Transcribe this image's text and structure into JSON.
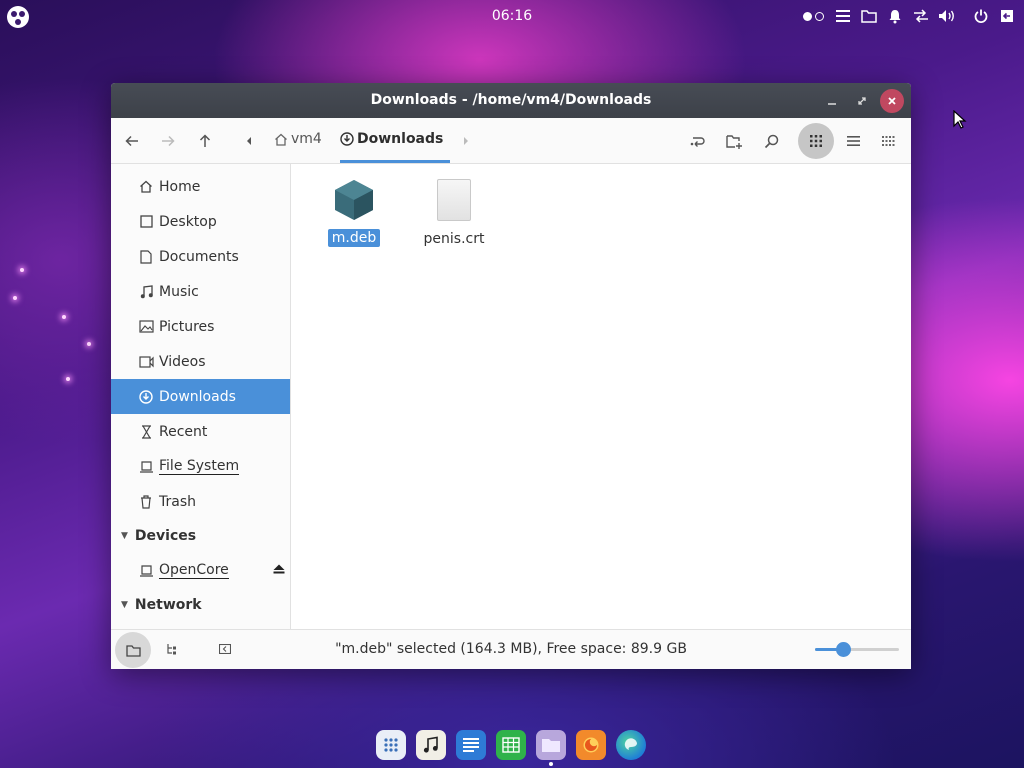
{
  "topbar": {
    "clock": "06:16",
    "tray_icons": [
      "workspace-dots-icon",
      "menu-icon",
      "folder-icon",
      "bell-icon",
      "network-icon",
      "volume-icon",
      "power-icon",
      "logout-icon"
    ]
  },
  "window": {
    "title": "Downloads - /home/vm4/Downloads"
  },
  "toolbar": {
    "breadcrumbs": [
      {
        "label": "vm4",
        "icon": "home-icon"
      },
      {
        "label": "Downloads",
        "icon": "download-icon"
      }
    ]
  },
  "sidebar": {
    "places": [
      {
        "label": "Home",
        "icon": "home-icon"
      },
      {
        "label": "Desktop",
        "icon": "desktop-icon"
      },
      {
        "label": "Documents",
        "icon": "document-icon"
      },
      {
        "label": "Music",
        "icon": "music-icon"
      },
      {
        "label": "Pictures",
        "icon": "pictures-icon"
      },
      {
        "label": "Videos",
        "icon": "videos-icon"
      },
      {
        "label": "Downloads",
        "icon": "download-icon",
        "selected": true
      },
      {
        "label": "Recent",
        "icon": "recent-icon"
      },
      {
        "label": "File System",
        "icon": "drive-icon"
      },
      {
        "label": "Trash",
        "icon": "trash-icon"
      }
    ],
    "devices_header": "Devices",
    "devices": [
      {
        "label": "OpenCore",
        "icon": "drive-icon"
      }
    ],
    "network_header": "Network"
  },
  "files": [
    {
      "name": "m.deb",
      "icon": "deb-package-icon",
      "selected": true
    },
    {
      "name": "penis.crt",
      "icon": "certificate-file-icon",
      "selected": false
    }
  ],
  "statusbar": {
    "text": "\"m.deb\" selected (164.3 MB), Free space: 89.9 GB",
    "zoom_level": 0.33
  },
  "dock": {
    "items": [
      "apps-grid-icon",
      "music-app-icon",
      "writer-icon",
      "calc-icon",
      "files-icon",
      "firefox-icon",
      "edge-icon"
    ]
  },
  "colors": {
    "accent": "#4a90d9",
    "close": "#c04860",
    "titlebar": "#3d4149"
  }
}
